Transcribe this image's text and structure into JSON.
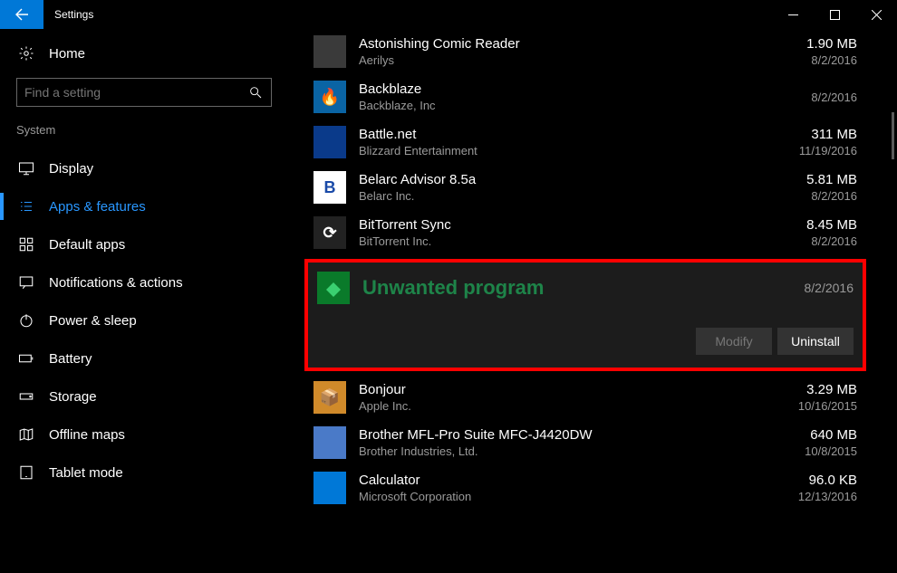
{
  "window": {
    "title": "Settings"
  },
  "home_label": "Home",
  "search": {
    "placeholder": "Find a setting"
  },
  "side_category": "System",
  "sidebar_items": [
    {
      "label": "Display"
    },
    {
      "label": "Apps & features"
    },
    {
      "label": "Default apps"
    },
    {
      "label": "Notifications & actions"
    },
    {
      "label": "Power & sleep"
    },
    {
      "label": "Battery"
    },
    {
      "label": "Storage"
    },
    {
      "label": "Offline maps"
    },
    {
      "label": "Tablet mode"
    }
  ],
  "partial_app": {
    "size": "–",
    "date": "–"
  },
  "apps": [
    {
      "name": "Astonishing Comic Reader",
      "publisher": "Aerilys",
      "size": "1.90 MB",
      "date": "8/2/2016",
      "icon_bg": "#3a3a3a",
      "icon_txt": ""
    },
    {
      "name": "Backblaze",
      "publisher": "Backblaze, Inc",
      "size": "",
      "date": "8/2/2016",
      "icon_bg": "#0a64a4",
      "icon_txt": "🔥"
    },
    {
      "name": "Battle.net",
      "publisher": "Blizzard Entertainment",
      "size": "311 MB",
      "date": "11/19/2016",
      "icon_bg": "#0a3a8a",
      "icon_txt": ""
    },
    {
      "name": "Belarc Advisor 8.5a",
      "publisher": "Belarc Inc.",
      "size": "5.81 MB",
      "date": "8/2/2016",
      "icon_bg": "#ffffff",
      "icon_txt": "B",
      "icon_fg": "#1a4aa8"
    },
    {
      "name": "BitTorrent Sync",
      "publisher": "BitTorrent Inc.",
      "size": "8.45 MB",
      "date": "8/2/2016",
      "icon_bg": "#222",
      "icon_txt": "⟳"
    }
  ],
  "selected": {
    "name": "Unwanted program",
    "date": "8/2/2016",
    "modify_label": "Modify",
    "uninstall_label": "Uninstall"
  },
  "apps_after": [
    {
      "name": "Bonjour",
      "publisher": "Apple Inc.",
      "size": "3.29 MB",
      "date": "10/16/2015",
      "icon_bg": "#d08a2a",
      "icon_txt": "📦"
    },
    {
      "name": "Brother MFL-Pro Suite MFC-J4420DW",
      "publisher": "Brother Industries, Ltd.",
      "size": "640 MB",
      "date": "10/8/2015",
      "icon_bg": "#4a7ac8",
      "icon_txt": ""
    },
    {
      "name": "Calculator",
      "publisher": "Microsoft Corporation",
      "size": "96.0 KB",
      "date": "12/13/2016",
      "icon_bg": "#0078d7",
      "icon_txt": ""
    }
  ]
}
